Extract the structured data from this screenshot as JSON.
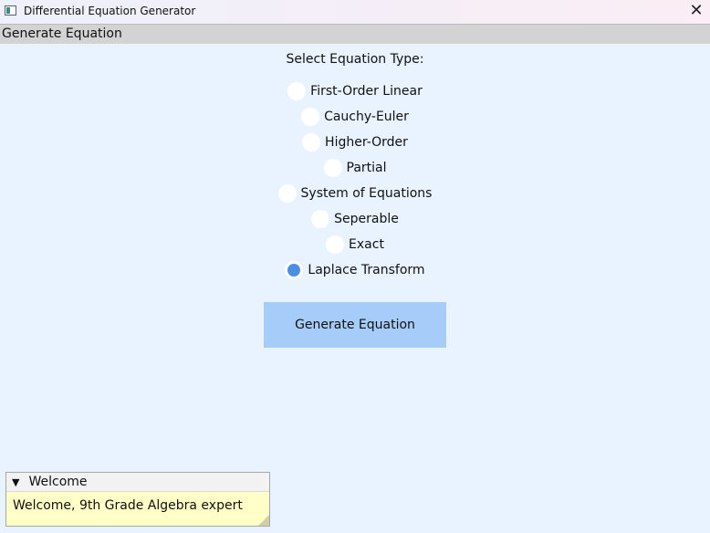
{
  "window": {
    "title": "Differential Equation Generator",
    "icon": "app-window-icon",
    "close_glyph": "✕"
  },
  "menubar": {
    "items": [
      {
        "label": "Generate Equation"
      }
    ]
  },
  "main": {
    "heading": "Select Equation Type:",
    "options": [
      {
        "label": "First-Order Linear",
        "selected": false
      },
      {
        "label": "Cauchy-Euler",
        "selected": false
      },
      {
        "label": "Higher-Order",
        "selected": false
      },
      {
        "label": "Partial",
        "selected": false
      },
      {
        "label": "System of Equations",
        "selected": false
      },
      {
        "label": "Seperable",
        "selected": false
      },
      {
        "label": "Exact",
        "selected": false
      },
      {
        "label": "Laplace Transform",
        "selected": true
      }
    ],
    "generate_button": "Generate Equation"
  },
  "notification": {
    "title": "Welcome",
    "toggle_glyph": "▼",
    "message": "Welcome, 9th Grade Algebra expert"
  },
  "colors": {
    "background": "#e8f3ff",
    "accent": "#4a90e2",
    "button": "#a6cdf9",
    "note": "#ffffc8"
  }
}
